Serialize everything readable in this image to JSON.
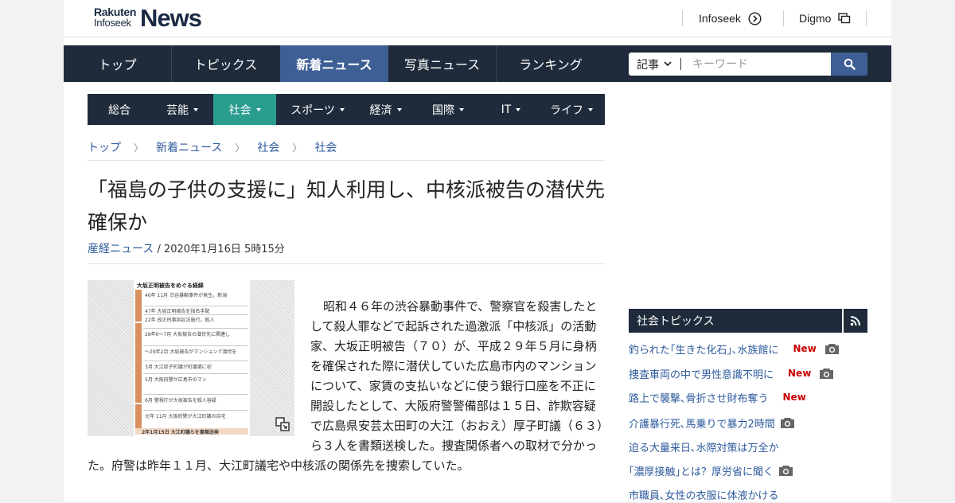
{
  "header": {
    "logo_small_1": "Rakuten",
    "logo_small_2": "Infoseek",
    "logo_big": "News",
    "links": [
      {
        "label": "Infoseek",
        "icon": "arrow-circle-icon"
      },
      {
        "label": "Digmo",
        "icon": "windows-icon"
      }
    ]
  },
  "main_nav": {
    "items": [
      {
        "label": "トップ",
        "active": false
      },
      {
        "label": "トピックス",
        "active": false
      },
      {
        "label": "新着ニュース",
        "active": true
      },
      {
        "label": "写真ニュース",
        "active": false
      },
      {
        "label": "ランキング",
        "active": false
      }
    ]
  },
  "search": {
    "select_value": "記事",
    "placeholder": "キーワード",
    "icon": "search-icon"
  },
  "sub_nav": {
    "items": [
      {
        "label": "総合",
        "dropdown": false,
        "active": false
      },
      {
        "label": "芸能",
        "dropdown": true,
        "active": false
      },
      {
        "label": "社会",
        "dropdown": true,
        "active": true
      },
      {
        "label": "スポーツ",
        "dropdown": true,
        "active": false
      },
      {
        "label": "経済",
        "dropdown": true,
        "active": false
      },
      {
        "label": "国際",
        "dropdown": true,
        "active": false
      },
      {
        "label": "IT",
        "dropdown": true,
        "active": false
      },
      {
        "label": "ライフ",
        "dropdown": true,
        "active": false
      }
    ]
  },
  "breadcrumb": [
    "トップ",
    "新着ニュース",
    "社会",
    "社会"
  ],
  "article": {
    "title": "「福島の子供の支援に」知人利用し、中核派被告の潜伏先確保か",
    "source": "産経ニュース",
    "date": " / 2020年1月16日 5時15分",
    "figure": {
      "title": "大坂正明被告をめぐる経緯",
      "lines": [
        "46年 11月 渋谷暴動事件が発生。新潟",
        "47年 大坂正明被告を指名手配",
        "22年 改正刑事訴訟法施行。殺人",
        "28年6〜7月 大坂被告の潜伏先に関連し",
        "〜29年2月 大坂被告がマンションで潜伏を",
        "3月 大江厚子町議が町議選に初",
        "5月 大阪府警が広島市のマン",
        "6月 警視庁が大坂被告を殺人容疑",
        "元年 11月 大阪府警が大江町議の自宅",
        "2年1月15日 大江町議らを書類送検"
      ]
    },
    "body": "昭和４６年の渋谷暴動事件で、警察官を殺害したとして殺人罪などで起訴された過激派「中核派」の活動家、大坂正明被告（７０）が、平成２９年５月に身柄を確保された際に潜伏していた広島市内のマンションについて、家賃の支払いなどに使う銀行口座を不正に開設したとして、大阪府警警備部は１５日、詐欺容疑で広島県安芸太田町の大江（おおえ）厚子町議（６３）ら３人を書類送検した。捜査関係者への取材で分かった。府警は昨年１１月、大江町議宅や中核派の関係先を捜索していた。"
  },
  "sidebar": {
    "heading": "社会トピックス",
    "rss_icon": "rss-icon",
    "topics": [
      {
        "title": "釣られた｢生きた化石｣､水族館に",
        "new": "New",
        "camera": true
      },
      {
        "title": "捜査車両の中で男性意識不明に",
        "new": "New",
        "camera": true
      },
      {
        "title": "路上で襲撃､骨折させ財布奪う",
        "new": "New",
        "camera": false
      },
      {
        "title": "介護暴行死､馬乗りで暴力2時間",
        "new": "",
        "camera": true
      },
      {
        "title": "迫る大量来日､水際対策は万全か",
        "new": "",
        "camera": false
      },
      {
        "title": "｢濃厚接触｣とは？厚労省に聞く",
        "new": "",
        "camera": true
      },
      {
        "title": "市職員､女性の衣服に体液かける",
        "new": "",
        "camera": false
      }
    ]
  },
  "colors": {
    "nav_bg": "#1f2b3a",
    "nav_active": "#3e5f95",
    "subnav_active": "#2a9d8f",
    "link": "#2d5a9c",
    "new_badge": "#cc0000"
  }
}
